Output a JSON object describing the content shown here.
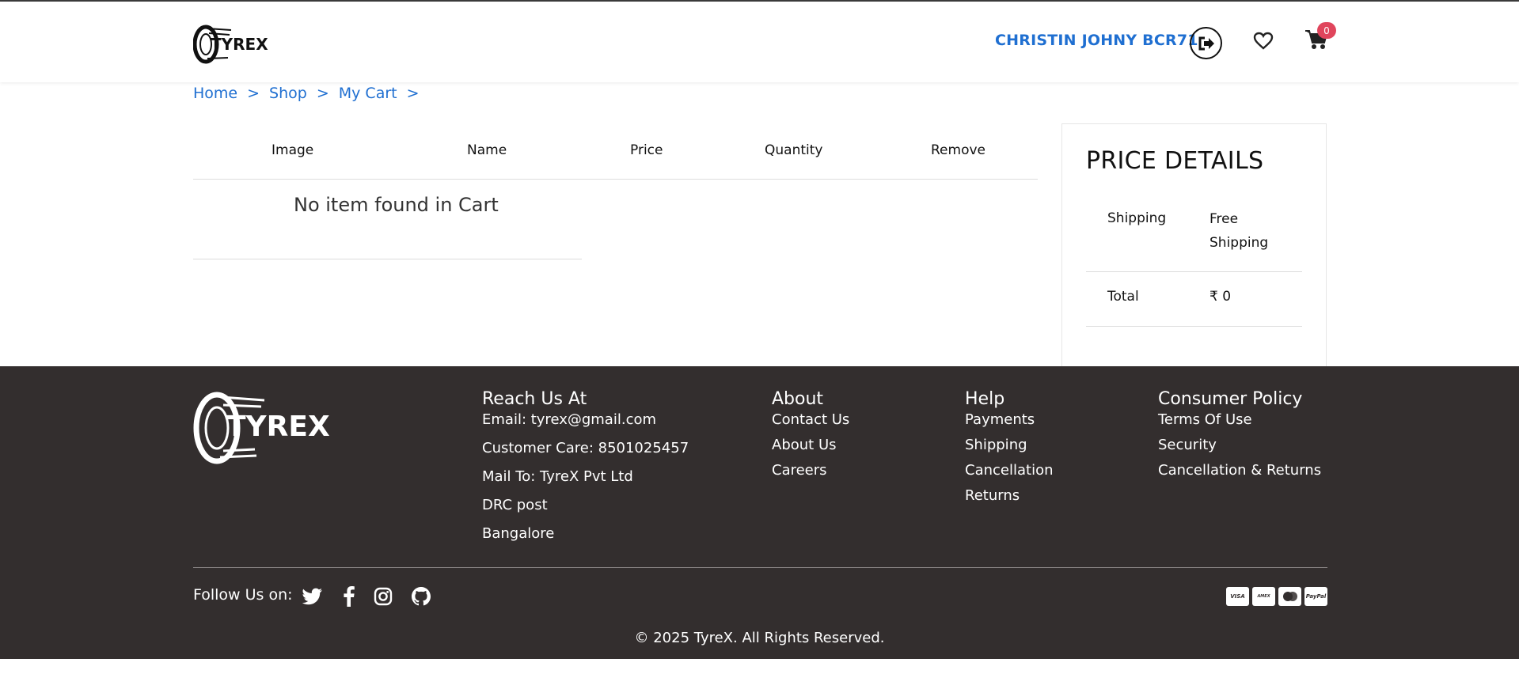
{
  "header": {
    "logo_text": "TYREX",
    "user_name": "CHRISTIN JOHNY BCR71",
    "cart_count": "0"
  },
  "breadcrumb": [
    {
      "label": "Home"
    },
    {
      "label": "Shop"
    },
    {
      "label": "My Cart"
    }
  ],
  "breadcrumb_separator": ">",
  "cart_table": {
    "columns": [
      "Image",
      "Name",
      "Price",
      "Quantity",
      "Remove"
    ],
    "empty_message": "No item found in Cart"
  },
  "price_details": {
    "title": "PRICE DETAILS",
    "rows": [
      {
        "label": "Shipping",
        "value": "Free Shipping"
      },
      {
        "label": "Total",
        "value": "₹ 0"
      }
    ]
  },
  "footer": {
    "logo_text": "TYREX",
    "reach": {
      "title": "Reach Us At",
      "items": [
        "Email: tyrex@gmail.com",
        "Customer Care: 8501025457",
        "Mail To: TyreX Pvt Ltd",
        "DRC post",
        "Bangalore"
      ]
    },
    "about": {
      "title": "About",
      "items": [
        "Contact Us",
        "About Us",
        "Careers"
      ]
    },
    "help": {
      "title": "Help",
      "items": [
        "Payments",
        "Shipping",
        "Cancellation",
        "Returns"
      ]
    },
    "consumer": {
      "title": "Consumer Policy",
      "items": [
        "Terms Of Use",
        "Security",
        "Cancellation & Returns"
      ]
    },
    "follow_label": "Follow Us on:",
    "social_icons": [
      "twitter-icon",
      "facebook-icon",
      "instagram-icon",
      "github-icon"
    ],
    "payment_icons": [
      "visa-icon",
      "amex-icon",
      "mastercard-icon",
      "paypal-icon"
    ],
    "copyright": "© 2025 TyreX. All Rights Reserved."
  },
  "colors": {
    "link_blue": "#1f6fd1",
    "footer_bg": "#332e2e",
    "badge_red": "#e0455c"
  }
}
